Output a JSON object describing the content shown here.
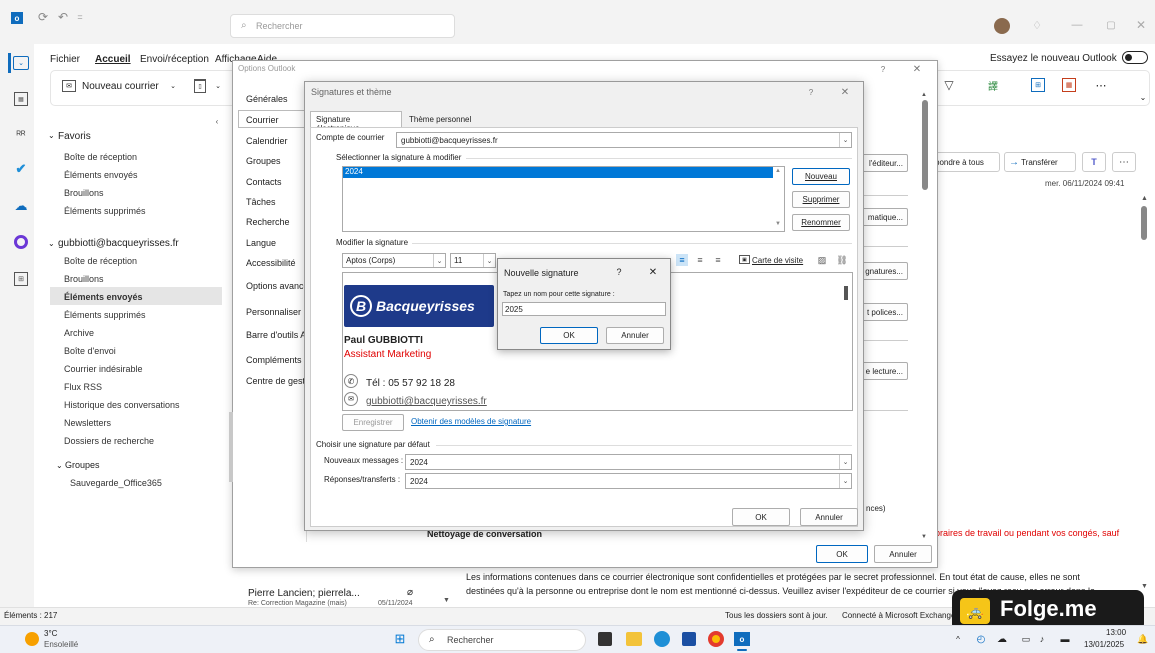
{
  "titlebar": {
    "search": "Rechercher"
  },
  "menu": [
    "Fichier",
    "Accueil",
    "Envoi/réception",
    "Affichage",
    "Aide"
  ],
  "try_new": "Essayez le nouveau Outlook",
  "ribbon": {
    "new_mail": "Nouveau courrier"
  },
  "folders": {
    "favorites": "Favoris",
    "fav_items": [
      "Boîte de réception",
      "Éléments envoyés",
      "Brouillons",
      "Éléments supprimés"
    ],
    "account": "gubbiotti@bacqueyrisses.fr",
    "acc_items": [
      "Boîte de réception",
      "Brouillons",
      "Éléments envoyés",
      "Éléments supprimés",
      "Archive",
      "Boîte d'envoi",
      "Courrier indésirable",
      "Flux RSS",
      "Historique des conversations",
      "Newsletters",
      "Dossiers de recherche"
    ],
    "groups": "Groupes",
    "group_items": [
      "Sauvegarde_Office365"
    ]
  },
  "options": {
    "title": "Options Outlook",
    "items": [
      "Générales",
      "Courrier",
      "Calendrier",
      "Groupes",
      "Contacts",
      "Tâches",
      "Recherche",
      "Langue",
      "Accessibilité",
      "Options avancées",
      "Personnaliser le",
      "Barre d'outils A",
      "Compléments",
      "Centre de gestion"
    ],
    "right_buttons": [
      "l'éditeur...",
      "matique...",
      "gnatures...",
      "t polices...",
      "e lecture..."
    ],
    "side_text": "nces)",
    "cleanup": "Nettoyage de conversation",
    "ok": "OK",
    "cancel": "Annuler"
  },
  "sig": {
    "title": "Signatures et thème",
    "tab1": "Signature électronique",
    "tab2": "Thème personnel",
    "account_label": "Compte de courrier",
    "account_value": "gubbiotti@bacqueyrisses.fr",
    "select_label": "Sélectionner la signature à modifier",
    "list_item": "2024",
    "new": "Nouveau",
    "delete": "Supprimer",
    "rename": "Renommer",
    "edit_label": "Modifier la signature",
    "font": "Aptos (Corps)",
    "size": "11",
    "color": "Automatique",
    "card": "Carte de visite",
    "logo_text": "Bacqueyrisses",
    "name": "Paul GUBBIOTTI",
    "role": "Assistant Marketing",
    "phone": "Tél : 05 57 92 18 28",
    "email": "gubbiotti@bacqueyrisses.fr",
    "save": "Enregistrer",
    "templates": "Obtenir des modèles de signature",
    "default_label": "Choisir une signature par défaut",
    "new_msg_label": "Nouveaux messages :",
    "new_msg_value": "2024",
    "reply_label": "Réponses/transferts :",
    "reply_value": "2024",
    "ok": "OK",
    "cancel": "Annuler"
  },
  "newsig": {
    "title": "Nouvelle signature",
    "prompt": "Tapez un nom pour cette signature :",
    "value": "2025",
    "ok": "OK",
    "cancel": "Annuler"
  },
  "reading": {
    "reply_all": "pondre à tous",
    "forward": "Transférer",
    "date": "mer. 06/11/2024 09:41",
    "red_text": "braires de travail ou pendant vos congés, sauf",
    "footer1": "Les informations contenues dans ce courrier électronique sont confidentielles et protégées par le secret professionnel. En tout état de cause, elles ne sont",
    "footer2": "destinées qu'à la personne ou entreprise dont le nom est mentionné ci-dessus. Veuillez aviser l'expéditeur de ce courrier si vous l'avez reçu par erreur dans la"
  },
  "msg": {
    "sender": "Pierre Lancien; pierrela...",
    "subject": "Re: Correction Magazine (mais)",
    "date": "05/11/2024"
  },
  "status": {
    "items": "Éléments : 217",
    "sync": "Tous les dossiers sont à jour.",
    "conn": "Connecté à Microsoft Exchange"
  },
  "watermark": "Folge.me",
  "taskbar": {
    "temp": "3°C",
    "weather": "Ensoleillé",
    "search": "Rechercher",
    "time": "13:00",
    "date": "13/01/2025"
  }
}
